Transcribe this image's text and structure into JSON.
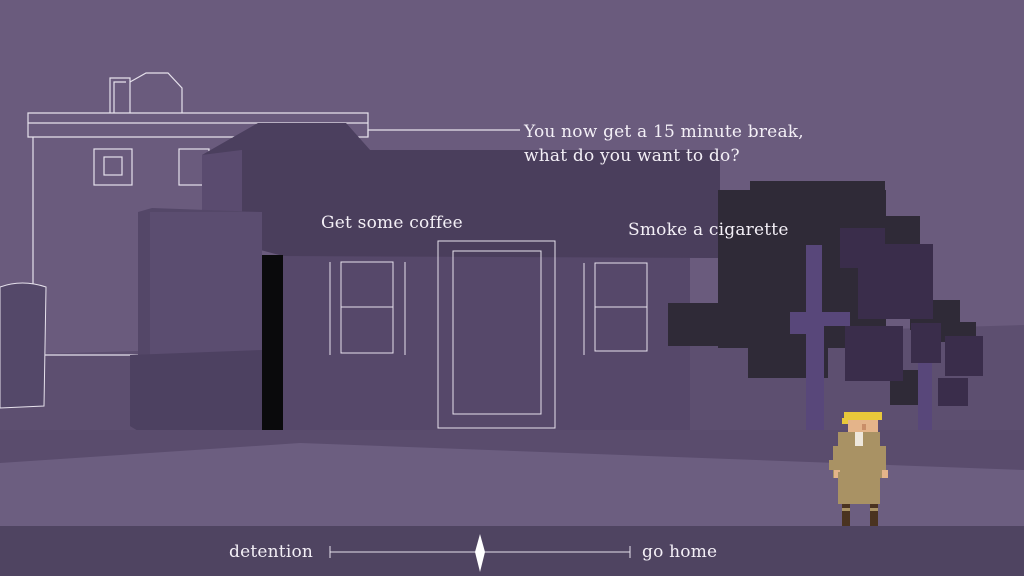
{
  "dialog": {
    "prompt_line1": "You now get a 15 minute break,",
    "prompt_line2": "what do you want to do?",
    "choice_left": "Get some coffee",
    "choice_right": "Smoke a cigarette"
  },
  "timeline": {
    "left_label": "detention",
    "right_label": "go home",
    "position": 0.5
  },
  "colors": {
    "sky": "#6a5b7d",
    "text": "#f3eff6",
    "ground": "#4f4461"
  }
}
